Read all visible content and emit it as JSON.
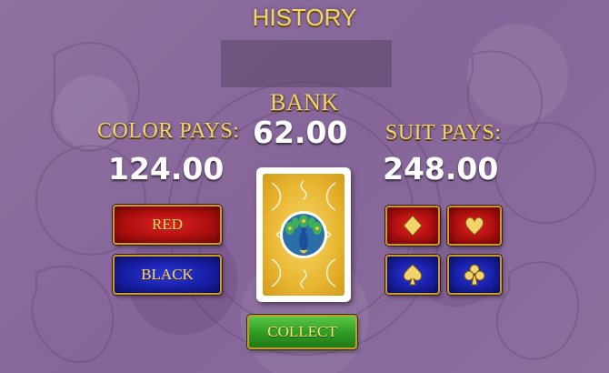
{
  "history": {
    "title": "HISTORY"
  },
  "bank": {
    "label": "BANK",
    "value": "62.00"
  },
  "color_pays": {
    "label": "COLOR PAYS:",
    "value": "124.00"
  },
  "suit_pays": {
    "label": "SUIT PAYS:",
    "value": "248.00"
  },
  "color_buttons": {
    "red": "RED",
    "black": "BLACK"
  },
  "suit_buttons": [
    "diamond-icon",
    "heart-icon",
    "spade-icon",
    "club-icon"
  ],
  "collect": {
    "label": "COLLECT"
  },
  "card": {
    "back_design": "peacock-icon"
  },
  "colors": {
    "gold": "#f3d46a",
    "red": "#b00f10",
    "blue": "#1820a8",
    "green": "#2f9a24",
    "background": "#8b6a9c"
  }
}
